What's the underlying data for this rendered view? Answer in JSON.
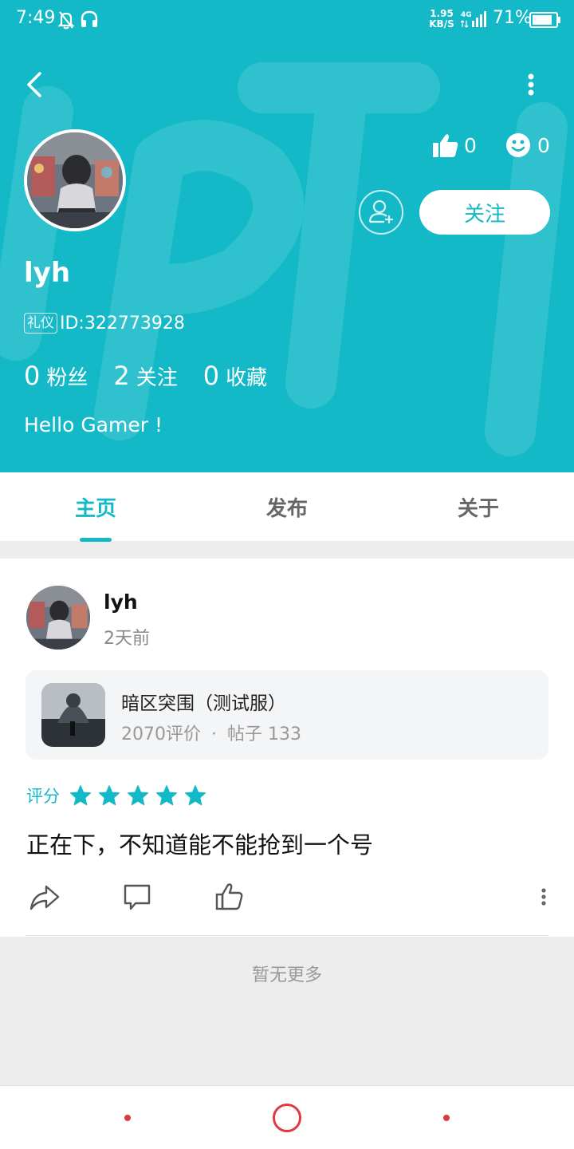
{
  "status_bar": {
    "time": "7:49",
    "net_speed_value": "1.95",
    "net_speed_unit": "KB/S",
    "network": "4G",
    "battery": "71%"
  },
  "profile": {
    "username": "lyh",
    "id_badge": "礼仪",
    "id_text": "ID:322773928",
    "likes": "0",
    "emoji": "0",
    "follow_label": "关注",
    "bio": "Hello Gamer !",
    "stats": [
      {
        "value": "0",
        "label": "粉丝"
      },
      {
        "value": "2",
        "label": "关注"
      },
      {
        "value": "0",
        "label": "收藏"
      }
    ]
  },
  "tabs": [
    {
      "label": "主页",
      "active": true
    },
    {
      "label": "发布",
      "active": false
    },
    {
      "label": "关于",
      "active": false
    }
  ],
  "post": {
    "username": "lyh",
    "time": "2天前",
    "game": {
      "title": "暗区突围（测试服）",
      "reviews": "2070评价",
      "separator": "·",
      "posts": "帖子 133"
    },
    "rating_label": "评分",
    "rating": 5,
    "content": "正在下，不知道能不能抢到一个号"
  },
  "footer": {
    "no_more": "暂无更多"
  },
  "colors": {
    "accent": "#14b9c8",
    "star": "#14b9c8",
    "nav": "#e0383e"
  }
}
